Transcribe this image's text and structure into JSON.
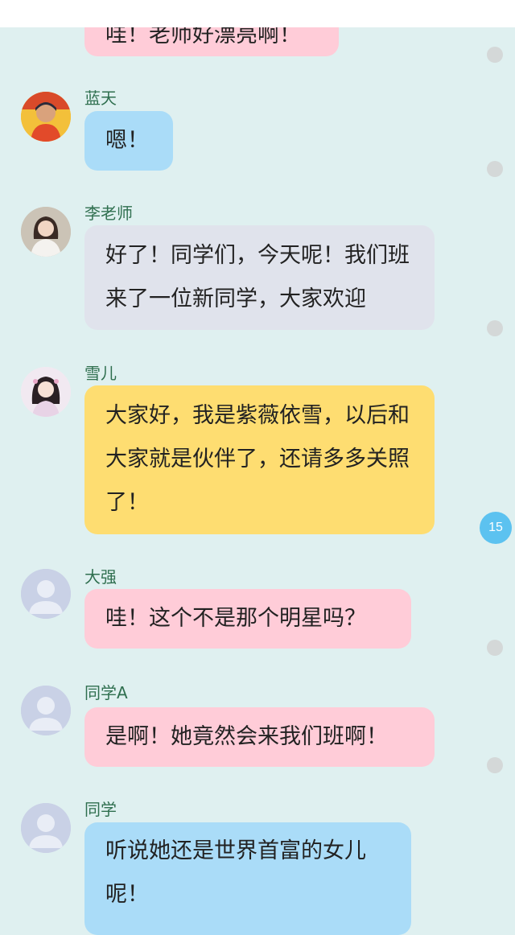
{
  "messages": [
    {
      "name": "",
      "text": "哇！老师好漂亮啊！",
      "color": "#ffccd8"
    },
    {
      "name": "蓝天",
      "text": "嗯！",
      "color": "#aadcf8",
      "avatar_icon": "boy-photo-avatar"
    },
    {
      "name": "李老师",
      "text": "好了！同学们，今天呢！我们班来了一位新同学，大家欢迎",
      "color": "#e0e3ec",
      "avatar_icon": "teacher-photo-avatar"
    },
    {
      "name": "雪儿",
      "text": "大家好，我是紫薇依雪，以后和大家就是伙伴了，还请多多关照了！",
      "color": "#fedd71",
      "avatar_icon": "girl-photo-avatar"
    },
    {
      "name": "大强",
      "text": "哇！这个不是那个明星吗？",
      "color": "#ffccd8",
      "avatar_icon": "default-user-avatar"
    },
    {
      "name": "同学A",
      "text": "是啊！她竟然会来我们班啊！",
      "color": "#ffccd8",
      "avatar_icon": "default-user-avatar"
    },
    {
      "name": "同学",
      "text": "听说她还是世界首富的女儿呢！",
      "color": "#aadcf8",
      "avatar_icon": "default-user-avatar"
    }
  ],
  "badge": {
    "count": "15"
  }
}
